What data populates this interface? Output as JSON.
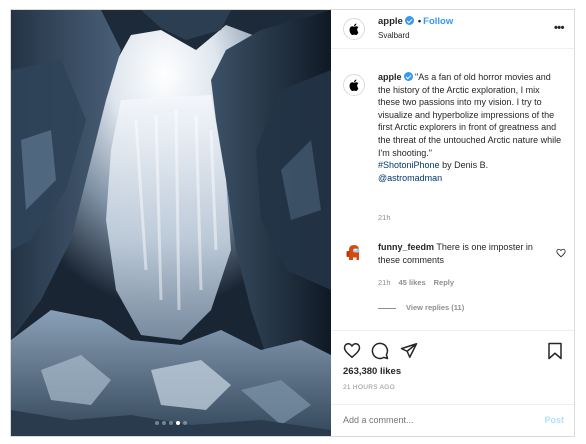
{
  "post": {
    "username": "apple",
    "separator": "•",
    "follow_label": "Follow",
    "location": "Svalbard",
    "more_label": "•••"
  },
  "caption": {
    "username": "apple",
    "text": "\"As a fan of old horror movies and the history of the Arctic exploration, I mix these two passions into my vision. I try to visualize and hyperbolize impressions of the first Arctic explorers in front of greatness and the threat of the untouched Arctic nature while I'm shooting.\"",
    "hashtag": "#ShotoniPhone",
    "by_text": "by Denis B.",
    "mention": "@astromadman",
    "time": "21h"
  },
  "comment": {
    "username": "funny_feedm",
    "text": "There is one imposter in these comments",
    "time": "21h",
    "likes": "45 likes",
    "reply_label": "Reply",
    "view_replies": "View replies (11)"
  },
  "stats": {
    "likes": "263,380 likes",
    "posted": "21 HOURS AGO"
  },
  "add_comment": {
    "placeholder": "Add a comment...",
    "post_label": "Post"
  },
  "carousel": {
    "count": 5,
    "active": 4
  },
  "icons": {
    "heart": "heart-icon",
    "comment": "comment-icon",
    "share": "share-icon",
    "save": "bookmark-icon",
    "apple": "apple-logo-icon",
    "verified": "verified-badge-icon"
  },
  "colors": {
    "accent": "#3897f0",
    "link": "#00376b",
    "muted": "#8e8e8e",
    "post_disabled": "#b2dffc"
  }
}
